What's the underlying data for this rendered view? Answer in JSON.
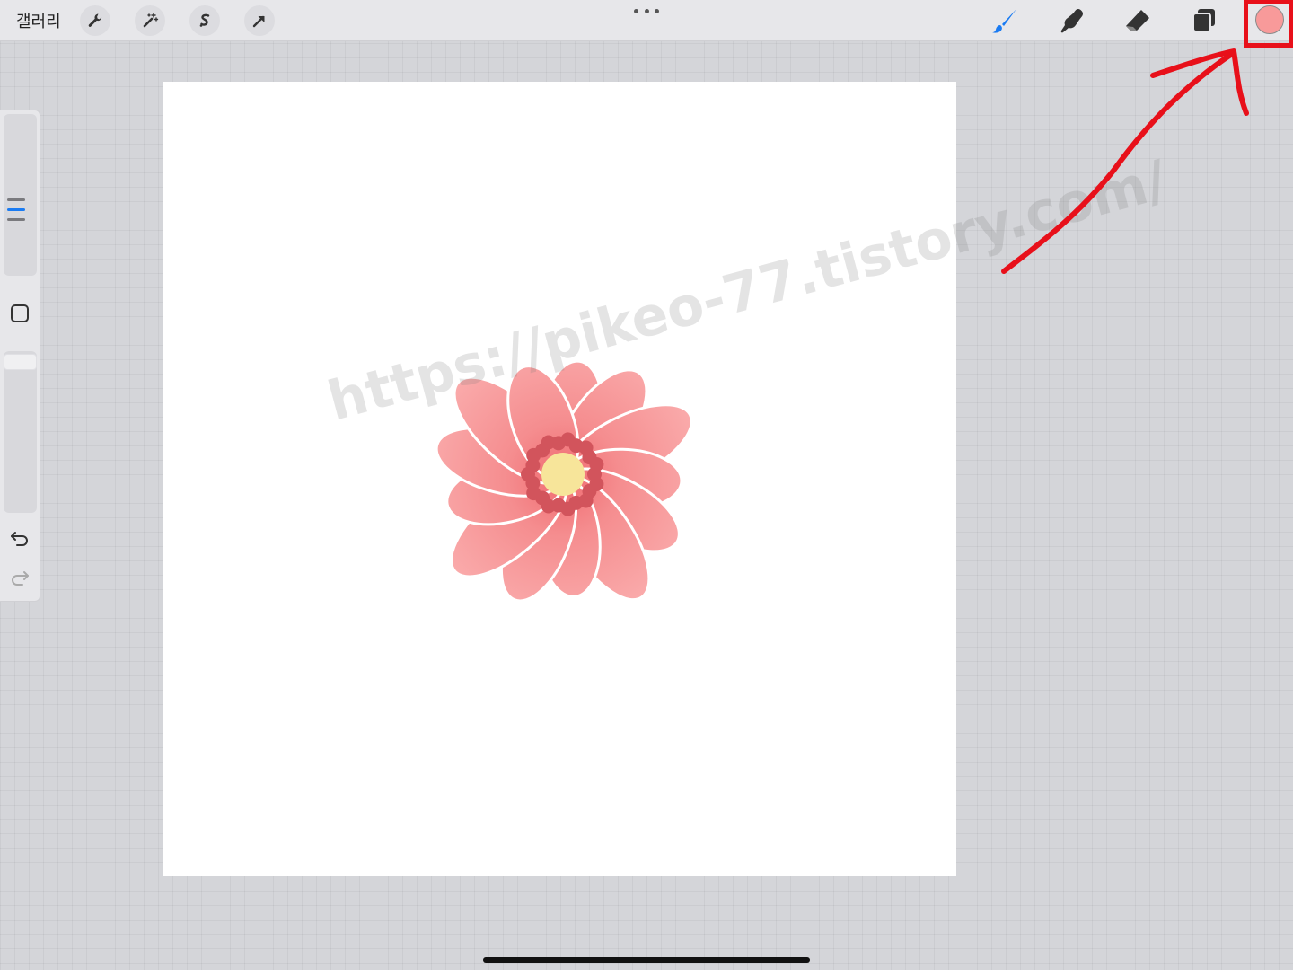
{
  "topbar": {
    "gallery_label": "갤러리",
    "left_tools": [
      {
        "name": "actions",
        "icon": "wrench-icon"
      },
      {
        "name": "adjustments",
        "icon": "magic-wand-icon"
      },
      {
        "name": "selection",
        "icon": "selection-s-icon"
      },
      {
        "name": "transform",
        "icon": "transform-arrow-icon"
      }
    ],
    "center_icon": "more-dots-icon",
    "right_tools": [
      {
        "name": "brush",
        "icon": "brush-icon",
        "active": true
      },
      {
        "name": "smudge",
        "icon": "smudge-icon"
      },
      {
        "name": "eraser",
        "icon": "eraser-icon"
      },
      {
        "name": "layers",
        "icon": "layers-icon"
      }
    ],
    "current_color": "#f89a9a"
  },
  "sidebar": {
    "size_slider_icon": "brush-size-slider",
    "modify_icon": "modify-square-icon",
    "opacity_slider_icon": "opacity-slider",
    "undo_icon": "undo-icon",
    "redo_icon": "redo-icon"
  },
  "canvas": {
    "background": "#ffffff",
    "artwork": "pink-flower",
    "watermark": "https://pikeo-77.tistory.com/"
  },
  "annotation": {
    "color": "#e8101a",
    "target": "color-swatch"
  },
  "colors": {
    "accent": "#1a7bf2",
    "petal": "#f8a2a2",
    "petal_center": "#f07878",
    "stamen": "#d2545c",
    "pollen": "#f7e59a"
  }
}
